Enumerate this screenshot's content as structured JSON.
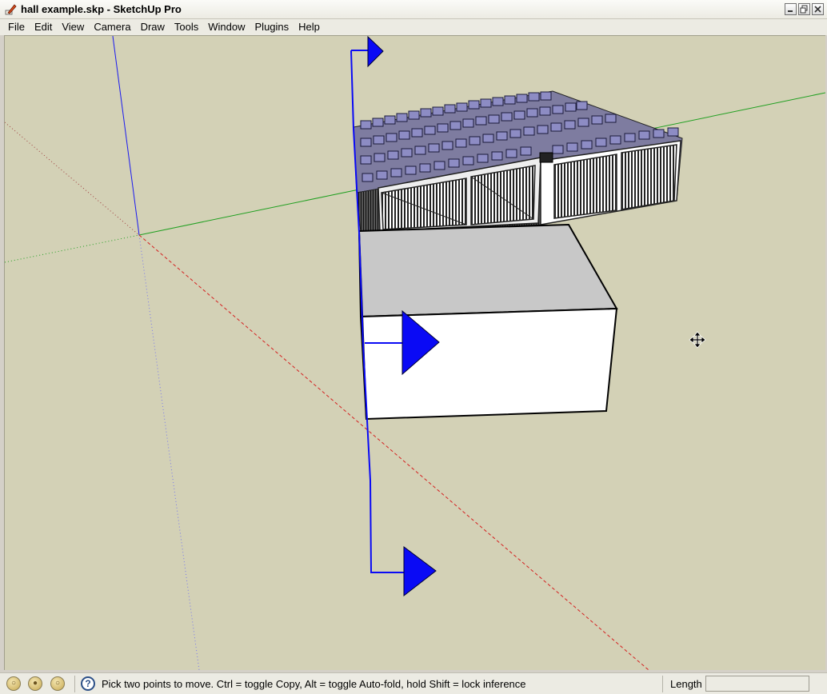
{
  "window": {
    "title": "hall example.skp - SketchUp Pro",
    "icon": "sketchup-pencil-icon",
    "buttons": [
      "minimize",
      "maximize",
      "close"
    ]
  },
  "menu": {
    "items": [
      "File",
      "Edit",
      "View",
      "Camera",
      "Draw",
      "Tools",
      "Window",
      "Plugins",
      "Help"
    ]
  },
  "viewport": {
    "background": "#d3d1b6",
    "axis_colors": {
      "red": "#d42020",
      "green": "#22a022",
      "blue": "#1a1af0"
    },
    "cursor": "move-cursor-icon",
    "model": "hall building with roof vents, grey box volume and blue arrow components"
  },
  "status": {
    "icons": [
      "geo-location-icon",
      "credits-icon",
      "sign-in-icon"
    ],
    "help_icon": "?",
    "message": "Pick two points to move.  Ctrl = toggle Copy, Alt = toggle Auto-fold, hold Shift = lock inference",
    "vcb_label": "Length",
    "vcb_value": ""
  }
}
